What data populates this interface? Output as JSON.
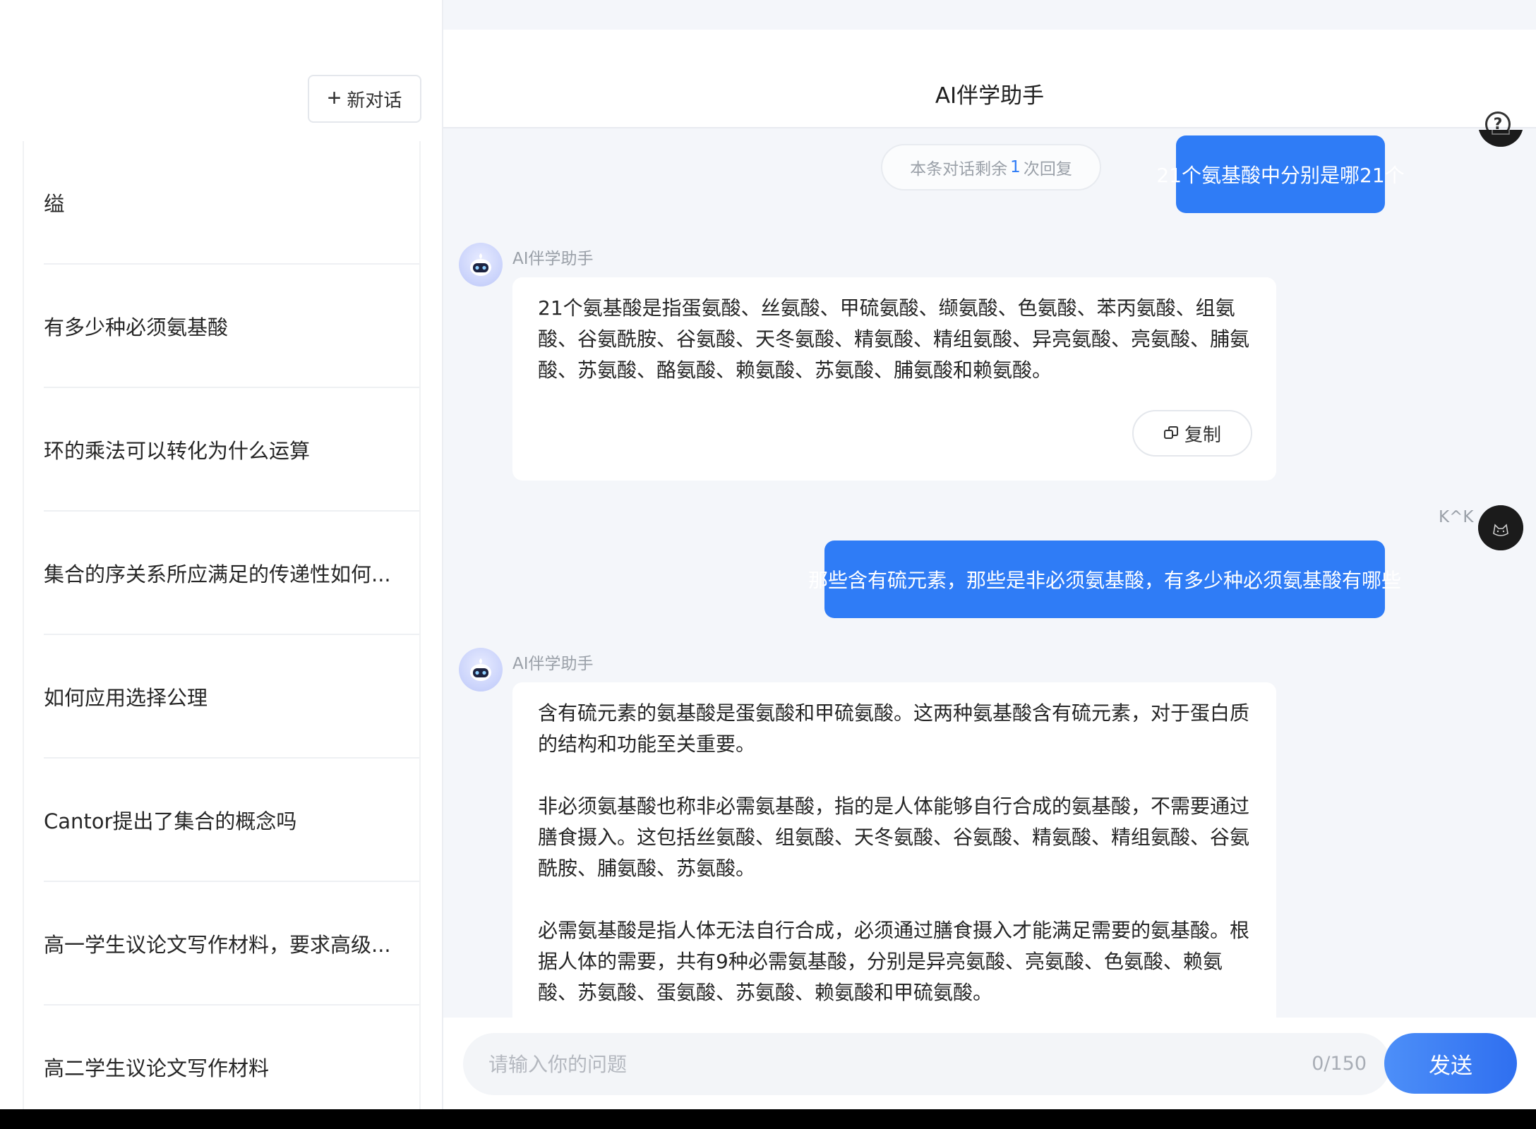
{
  "sidebar": {
    "new_chat_label": "新对话",
    "items": [
      {
        "label": "缢"
      },
      {
        "label": "有多少种必须氨基酸"
      },
      {
        "label": "环的乘法可以转化为什么运算"
      },
      {
        "label": "集合的序关系所应满足的传递性如何..."
      },
      {
        "label": "如何应用选择公理"
      },
      {
        "label": "Cantor提出了集合的概念吗"
      },
      {
        "label": "高一学生议论文写作材料，要求高级..."
      },
      {
        "label": "高二学生议论文写作材料"
      }
    ]
  },
  "header": {
    "title": "AI伴学助手",
    "help_icon": "question-circle-icon"
  },
  "chat": {
    "remaining_prefix": "本条对话剩余",
    "remaining_count": "1",
    "remaining_suffix": "次回复",
    "bot_name": "AI伴学助手",
    "user_name": "K^K",
    "messages": [
      {
        "role": "user",
        "text": "21个氨基酸中分别是哪21个"
      },
      {
        "role": "bot",
        "paragraphs": [
          "21个氨基酸是指蛋氨酸、丝氨酸、甲硫氨酸、缬氨酸、色氨酸、苯丙氨酸、组氨酸、谷氨酰胺、谷氨酸、天冬氨酸、精氨酸、精组氨酸、异亮氨酸、亮氨酸、脯氨酸、苏氨酸、酪氨酸、赖氨酸、苏氨酸、脯氨酸和赖氨酸。"
        ],
        "copy_label": "复制"
      },
      {
        "role": "user",
        "text": "那些含有硫元素，那些是非必须氨基酸，有多少种必须氨基酸有哪些"
      },
      {
        "role": "bot",
        "paragraphs": [
          "含有硫元素的氨基酸是蛋氨酸和甲硫氨酸。这两种氨基酸含有硫元素，对于蛋白质的结构和功能至关重要。",
          "非必须氨基酸也称非必需氨基酸，指的是人体能够自行合成的氨基酸，不需要通过膳食摄入。这包括丝氨酸、组氨酸、天冬氨酸、谷氨酸、精氨酸、精组氨酸、谷氨酰胺、脯氨酸、苏氨酸。",
          "必需氨基酸是指人体无法自行合成，必须通过膳食摄入才能满足需要的氨基酸。根据人体的需要，共有9种必需氨基酸，分别是异亮氨酸、亮氨酸、色氨酸、赖氨酸、苏氨酸、蛋氨酸、苏氨酸、赖氨酸和甲硫氨酸。"
        ]
      }
    ]
  },
  "input": {
    "placeholder": "请输入你的问题",
    "value": "",
    "char_count": "0/150",
    "send_label": "发送"
  },
  "colors": {
    "accent": "#2f7cf6",
    "bubble_user_bg": "#2f7cf6",
    "main_bg": "#f4f6fa"
  }
}
